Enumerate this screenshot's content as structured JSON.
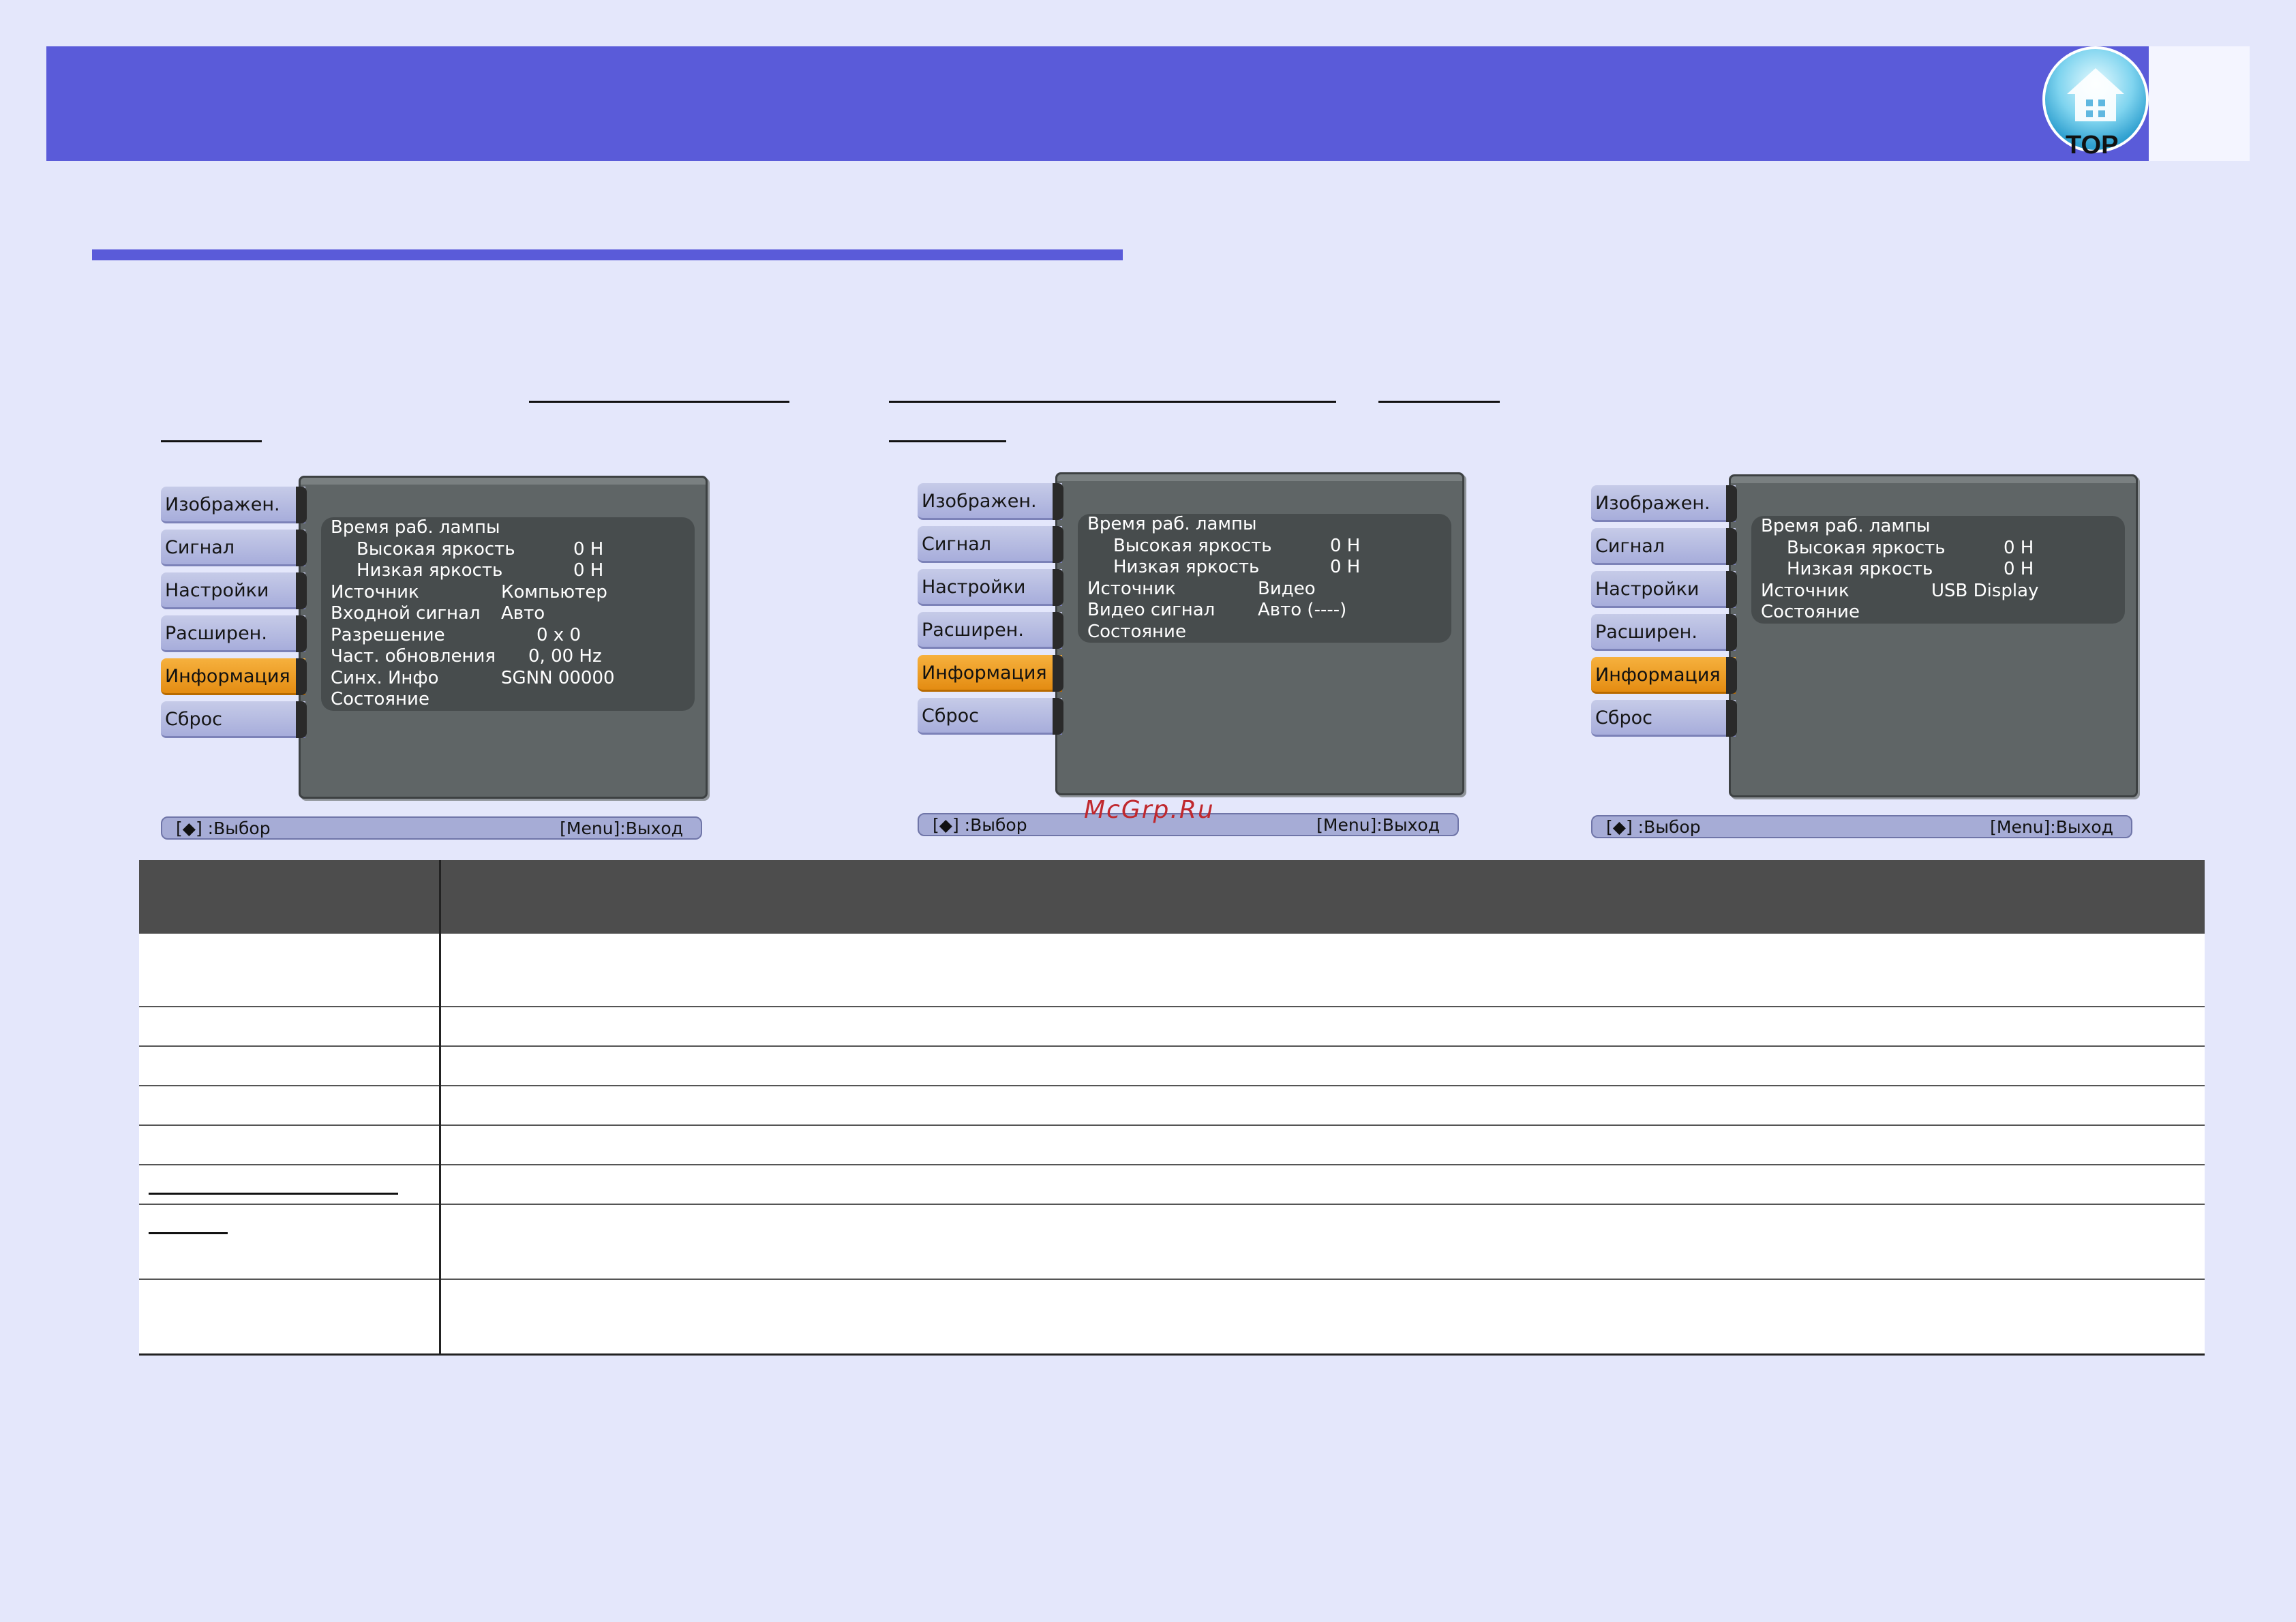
{
  "header": {
    "badge_text": "TOP",
    "badge_icon": "home-icon"
  },
  "watermark": "McGrp.Ru",
  "menus": [
    {
      "tabs": [
        "Изображен.",
        "Сигнал",
        "Настройки",
        "Расширен.",
        "Информация",
        "Сброс"
      ],
      "active_tab": 4,
      "rows": [
        {
          "label": "Время раб. лампы",
          "value": ""
        },
        {
          "label": "Высокая яркость",
          "value": "0  H",
          "indent": true
        },
        {
          "label": "Низкая яркость",
          "value": "0  H",
          "indent": true
        },
        {
          "label": "Источник",
          "value": "Компьютер"
        },
        {
          "label": "Входной сигнал",
          "value": "Авто"
        },
        {
          "label": "Разрешение",
          "value": "0  x       0"
        },
        {
          "label": "Част. обновления",
          "value": "0, 00 Hz"
        },
        {
          "label": "Синх. Инфо",
          "value": "SGNN 00000"
        },
        {
          "label": "Состояние",
          "value": ""
        }
      ],
      "status_left": "[◆] :Выбор",
      "status_right": "[Menu]:Выход"
    },
    {
      "tabs": [
        "Изображен.",
        "Сигнал",
        "Настройки",
        "Расширен.",
        "Информация",
        "Сброс"
      ],
      "active_tab": 4,
      "rows": [
        {
          "label": "Время раб. лампы",
          "value": ""
        },
        {
          "label": "Высокая яркость",
          "value": "0  H",
          "indent": true
        },
        {
          "label": "Низкая яркость",
          "value": "0  H",
          "indent": true
        },
        {
          "label": "Источник",
          "value": "Видео"
        },
        {
          "label": "Видео сигнал",
          "value": "Авто (----)"
        },
        {
          "label": "Состояние",
          "value": ""
        }
      ],
      "status_left": "[◆] :Выбор",
      "status_right": "[Menu]:Выход"
    },
    {
      "tabs": [
        "Изображен.",
        "Сигнал",
        "Настройки",
        "Расширен.",
        "Информация",
        "Сброс"
      ],
      "active_tab": 4,
      "rows": [
        {
          "label": "Время раб. лампы",
          "value": ""
        },
        {
          "label": "Высокая яркость",
          "value": "0  H",
          "indent": true
        },
        {
          "label": "Низкая яркость",
          "value": "0  H",
          "indent": true
        },
        {
          "label": "Источник",
          "value": "USB Display"
        },
        {
          "label": "Состояние",
          "value": ""
        }
      ],
      "status_left": "[◆] :Выбор",
      "status_right": "[Menu]:Выход"
    }
  ]
}
